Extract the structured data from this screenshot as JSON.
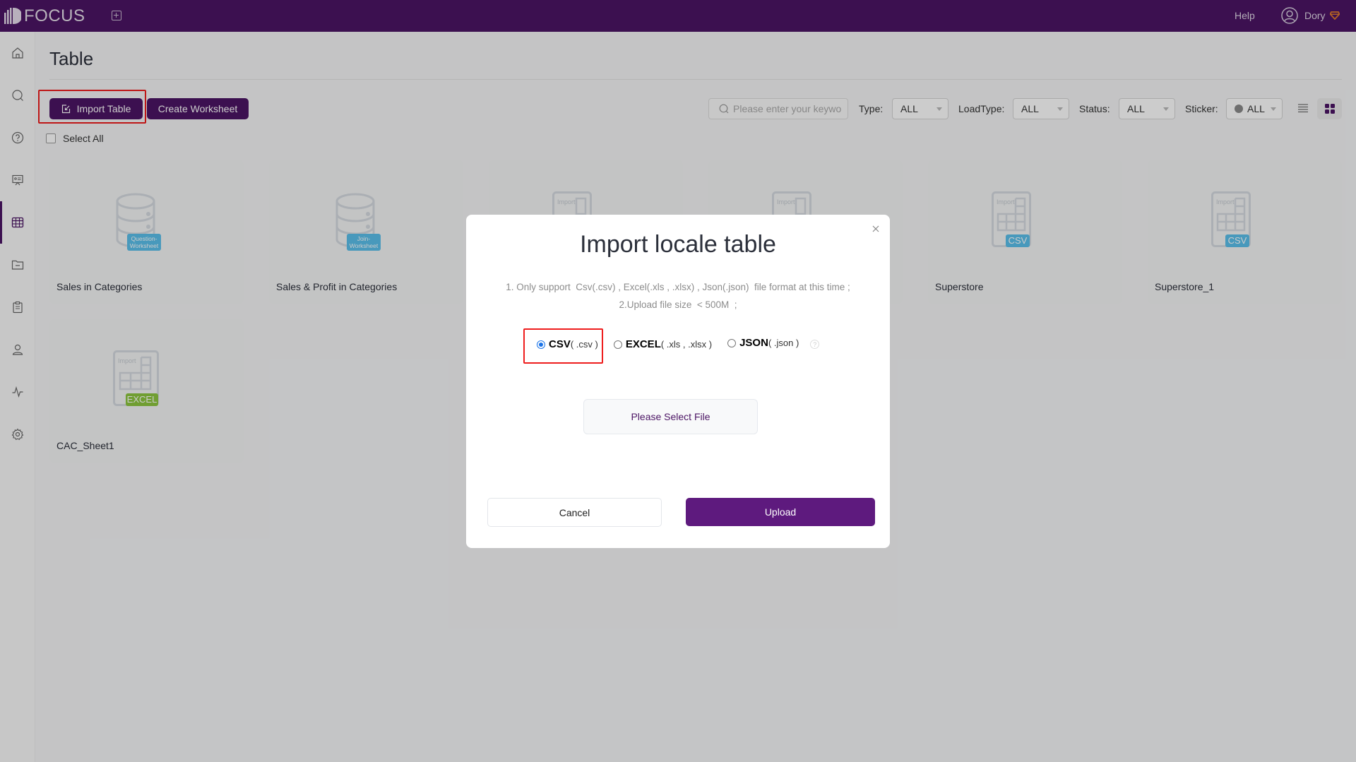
{
  "app": {
    "brand": "FOCUS",
    "help_label": "Help",
    "user_name": "Dory",
    "colors": {
      "brand": "#4c1564",
      "upload": "#5e1a7e",
      "highlight": "#ee1d1d",
      "csv_badge": "#5bc0eb",
      "excel_badge": "#8dc63f"
    }
  },
  "sidebar": {
    "items": [
      {
        "name": "home",
        "icon": "home-icon"
      },
      {
        "name": "search",
        "icon": "search-icon"
      },
      {
        "name": "question",
        "icon": "help-circle-icon"
      },
      {
        "name": "presentation",
        "icon": "presentation-icon"
      },
      {
        "name": "table",
        "icon": "table-icon",
        "active": true
      },
      {
        "name": "folder",
        "icon": "folder-icon"
      },
      {
        "name": "clipboard",
        "icon": "clipboard-icon"
      },
      {
        "name": "user",
        "icon": "user-icon"
      },
      {
        "name": "monitor",
        "icon": "pulse-icon"
      },
      {
        "name": "settings",
        "icon": "gear-icon"
      }
    ]
  },
  "page": {
    "title": "Table",
    "toolbar": {
      "import_label": "Import Table",
      "create_label": "Create Worksheet",
      "select_all_label": "Select All"
    },
    "filters": {
      "search_placeholder": "Please enter your keywo",
      "type_label": "Type:",
      "type_value": "ALL",
      "loadtype_label": "LoadType:",
      "loadtype_value": "ALL",
      "status_label": "Status:",
      "status_value": "ALL",
      "sticker_label": "Sticker:",
      "sticker_value": "ALL"
    },
    "cards": [
      {
        "name": "Sales in Categories",
        "kind": "worksheet",
        "badge": "Question-\nWorksheet"
      },
      {
        "name": "Sales & Profit in Categories",
        "kind": "worksheet",
        "badge": "Join-\nWorksheet"
      },
      {
        "name": "",
        "kind": "import",
        "badge": ""
      },
      {
        "name": "",
        "kind": "import",
        "badge": ""
      },
      {
        "name": "Superstore",
        "kind": "import",
        "badge": "CSV"
      },
      {
        "name": "Superstore_1",
        "kind": "import",
        "badge": "CSV"
      },
      {
        "name": "CAC_Sheet1",
        "kind": "import",
        "badge": "EXCEL"
      }
    ],
    "import_icon_label": "Import"
  },
  "modal": {
    "title": "Import locale table",
    "note1": "1. Only support  Csv(.csv) , Excel(.xls , .xlsx) , Json(.json)  file format at this time ;",
    "note2": "2.Upload file size  < 500M  ;",
    "options": [
      {
        "format": "CSV",
        "ext": "( .csv )",
        "checked": true
      },
      {
        "format": "EXCEL",
        "ext": "( .xls , .xlsx )",
        "checked": false
      },
      {
        "format": "JSON",
        "ext": "( .json )",
        "checked": false
      }
    ],
    "help_glyph": "?",
    "select_file_label": "Please Select File",
    "cancel_label": "Cancel",
    "upload_label": "Upload"
  }
}
